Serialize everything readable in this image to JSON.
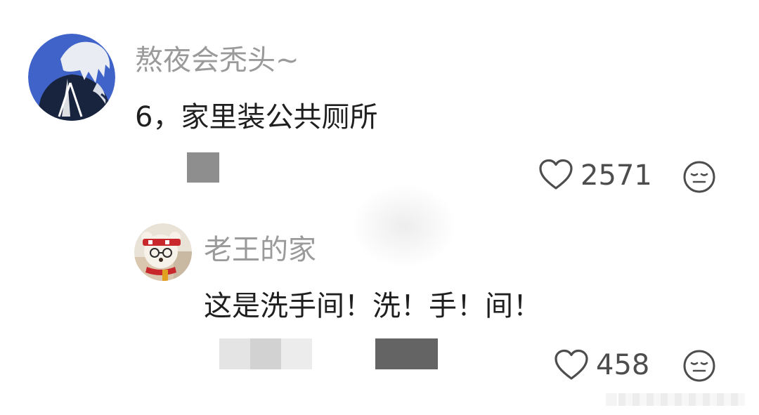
{
  "comments": [
    {
      "username": "熬夜会秃头~",
      "text": "6，家里装公共厕所",
      "like_count": "2571"
    },
    {
      "username": "老王的家",
      "text": "这是洗手间！洗！手！间！",
      "like_count": "458"
    }
  ],
  "icons": {
    "like": "heart-outline-icon",
    "reaction": "neutral-face-icon"
  }
}
